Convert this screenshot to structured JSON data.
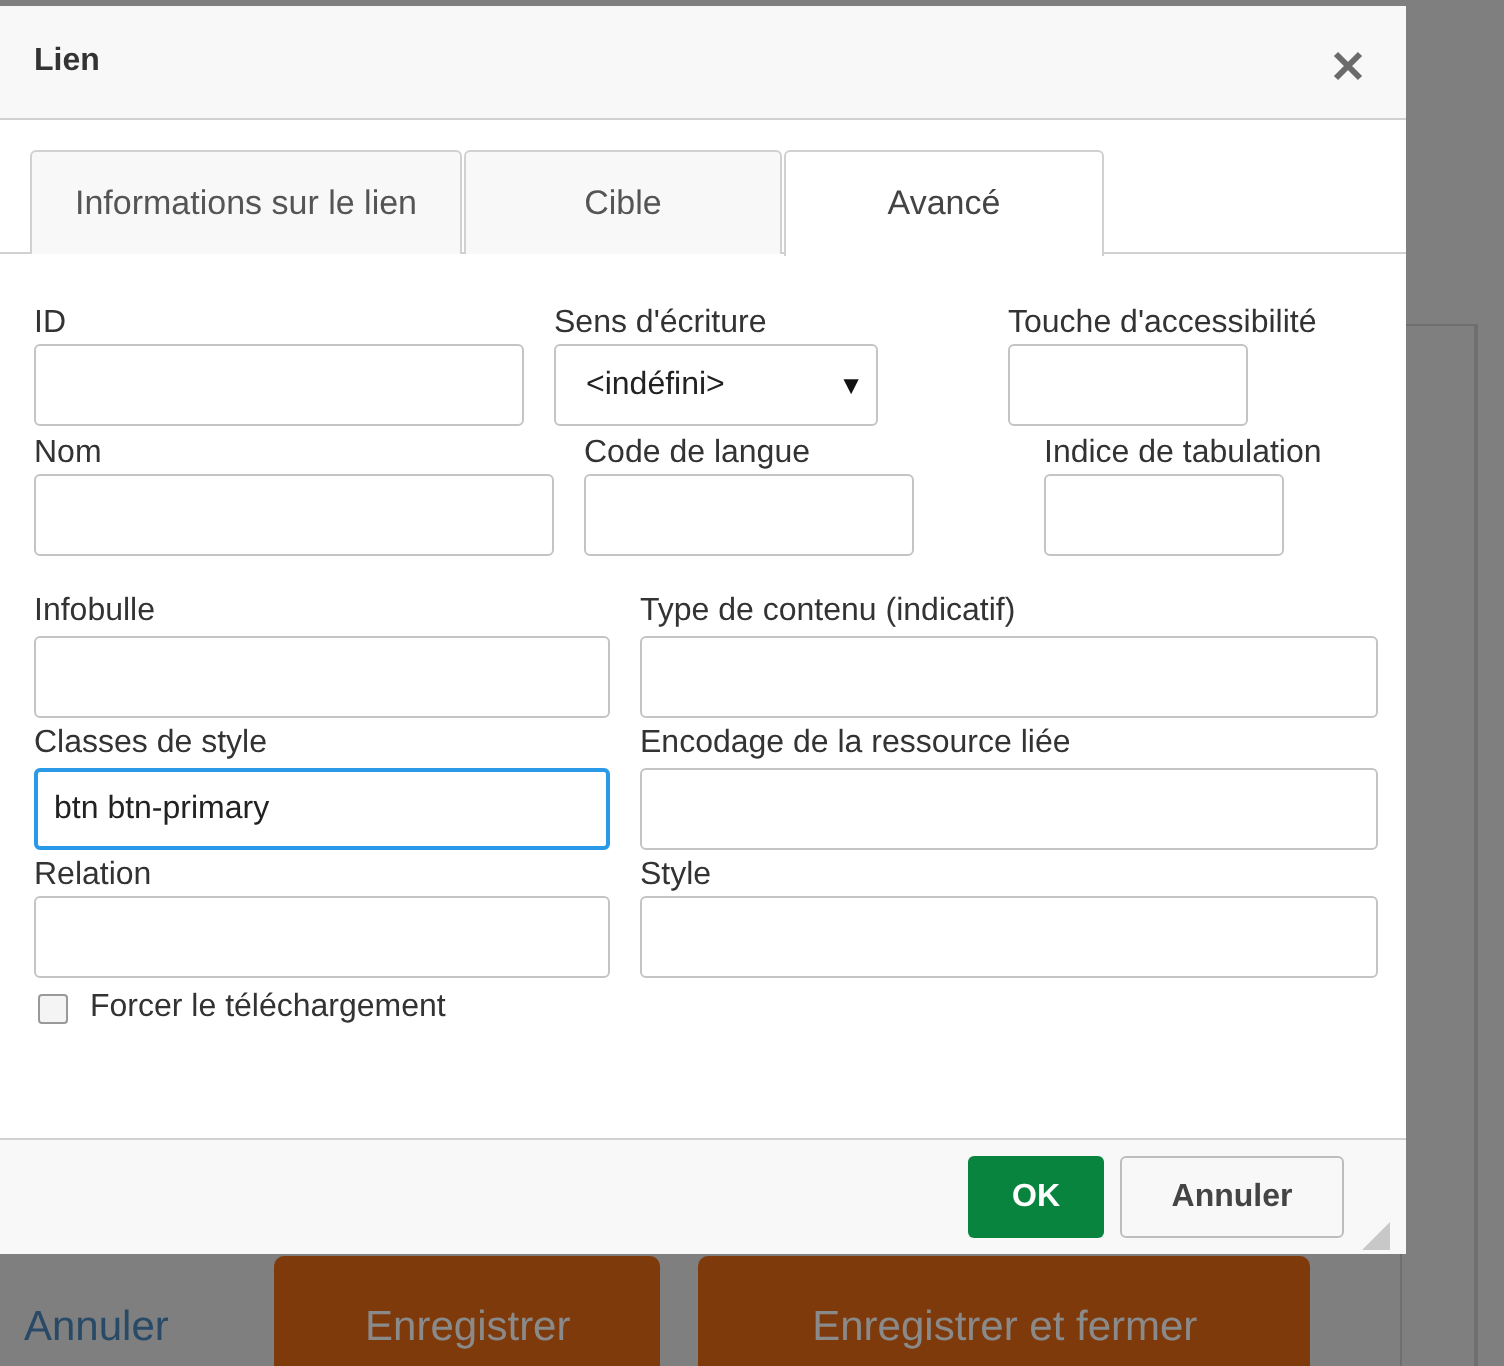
{
  "dialog": {
    "title": "Lien",
    "tabs": [
      {
        "label": "Informations sur le lien",
        "selected": false
      },
      {
        "label": "Cible",
        "selected": false
      },
      {
        "label": "Avancé",
        "selected": true
      }
    ],
    "rows": [
      [
        {
          "label": "ID",
          "kind": "input",
          "focused": false
        },
        {
          "label": "Sens d'écriture",
          "kind": "select",
          "value": "<indéfini>",
          "arrow": "▼",
          "focused": false
        },
        {
          "label": "Touche d'accessibilité",
          "kind": "input",
          "focused": false
        }
      ],
      [
        {
          "label": "Nom",
          "kind": "input",
          "focused": false
        },
        {
          "label": "Code de langue",
          "kind": "input",
          "focused": false
        },
        {
          "label": "Indice de tabulation",
          "kind": "input",
          "focused": false
        }
      ],
      [
        {
          "label": "Infobulle",
          "kind": "input",
          "focused": false
        },
        {
          "label": "Type de contenu (indicatif)",
          "kind": "input",
          "focused": false
        }
      ],
      [
        {
          "label": "Classes de style",
          "kind": "input",
          "value": "btn btn-primary",
          "focused": true
        },
        {
          "label": "Encodage de la ressource liée",
          "kind": "input",
          "focused": false
        }
      ],
      [
        {
          "label": "Relation",
          "kind": "input",
          "focused": false
        },
        {
          "label": "Style",
          "kind": "input",
          "focused": false
        }
      ]
    ],
    "checkbox": {
      "label": "Forcer le téléchargement",
      "checked": false
    },
    "buttons": [
      {
        "label": "OK",
        "kind": "primary"
      },
      {
        "label": "Annuler",
        "kind": "secondary"
      }
    ]
  },
  "background": {
    "link": "Annuler",
    "buttons": [
      "Enregistrer",
      "Enregistrer et fermer"
    ]
  }
}
